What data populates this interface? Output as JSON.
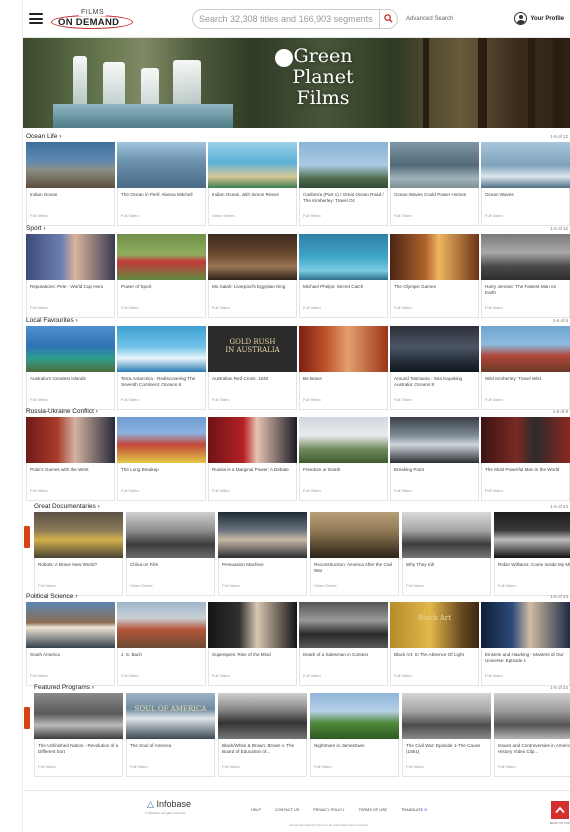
{
  "header": {
    "logo_top": "FILMS",
    "logo_main": "ON DEMAND",
    "search_placeholder": "Search 32,308 titles and 166,903 segments",
    "advanced_search": "Advanced Search",
    "profile_label": "Your Profile"
  },
  "banner": {
    "line1": "Green",
    "line2": "Planet",
    "line3": "Films"
  },
  "sections": [
    {
      "title": "Ocean Life",
      "count": "1-6 of 12",
      "cards": [
        {
          "title": "Indian Ocean",
          "type": "Full Video",
          "bg": "linear-gradient(180deg,#3e6f9c 0%,#5d89b1 40%,#8a8f86 60%,#5c4d3c 100%)"
        },
        {
          "title": "The Ocean in Peril: Alanna Mitchell",
          "type": "Full Video",
          "bg": "linear-gradient(180deg,#9ec3dd 0%,#6a8fab 45%,#4a6b86 100%)"
        },
        {
          "title": "Indian Ocean, with Simon Reeve",
          "type": "Video Series",
          "bg": "linear-gradient(180deg,#9dd0ea 0%,#5bb0d6 45%,#d8c796 75%,#3e7b52 100%)"
        },
        {
          "title": "Canberra (Part 1) / Great Ocean Road / The Kimberley: Travel Oz",
          "type": "Full Video",
          "bg": "linear-gradient(180deg,#8ab3d4 0%,#aacbe3 50%,#4d6b4a 80%,#2e4a36 100%)"
        },
        {
          "title": "Ocean Waves Could Power Homes",
          "type": "Full Video",
          "bg": "linear-gradient(180deg,#7f97a6 0%,#536b78 50%,#9fb3bc 80%,#7f8f95 100%)"
        },
        {
          "title": "Ocean Waves",
          "type": "Full Video",
          "bg": "linear-gradient(180deg,#a9c6db 0%,#7ea2ba 50%,#dbe6ec 75%,#4d6f86 100%)"
        }
      ]
    },
    {
      "title": "Sport",
      "count": "1-6 of 12",
      "cards": [
        {
          "title": "Reputations: Pele - World Cup Hero",
          "type": "Full Video",
          "bg": "linear-gradient(90deg,#3d4a7a 0%,#6c7fae 40%,#d8b49a 55%,#3a3a52 100%)"
        },
        {
          "title": "Power of Sport",
          "type": "Full Video",
          "bg": "linear-gradient(180deg,#6f8f4a 0%,#8fae5c 45%,#c4383a 60%,#5f8b3e 100%)"
        },
        {
          "title": "Mo Salah: Liverpool's Egyptian King",
          "type": "Full Video",
          "bg": "linear-gradient(180deg,#3a2a1e 0%,#6c4a30 45%,#9a7556 70%,#2e241b 100%)"
        },
        {
          "title": "Michael Phelps: Secret Catch",
          "type": "Full Video",
          "bg": "linear-gradient(180deg,#2f7fa6 0%,#3fa7c9 50%,#7ccbe0 80%,#2b6f8e 100%)"
        },
        {
          "title": "The Olympic Games",
          "type": "Full Video",
          "bg": "linear-gradient(90deg,#4a2413 0%,#b0632b 40%,#f0b562 55%,#6b3418 100%)"
        },
        {
          "title": "Harry Jerome: The Fastest Man on Earth",
          "type": "Full Video",
          "bg": "linear-gradient(180deg,#7a7a7a 0%,#a9a9a9 40%,#4a4a4a 70%,#2d2d2d 100%)"
        }
      ]
    },
    {
      "title": "Local Favourites",
      "count": "1-6 of 6",
      "cards": [
        {
          "title": "Australia's Greatest Islands",
          "type": "Full Video",
          "bg": "linear-gradient(180deg,#4f90d0 0%,#2f73b4 45%,#2e9e8e 70%,#4e6b3a 100%)"
        },
        {
          "title": "Terra Antarctica - Rediscovering The Seventh Continent: Oceans 8",
          "type": "Full Video",
          "bg": "linear-gradient(180deg,#3f9fd1 0%,#6fc2e6 45%,#e9f5fb 70%,#2c7db3 100%)"
        },
        {
          "title": "Australian Red Cross, 1940",
          "type": "Full Video",
          "bg": "#2b2b2b",
          "text": "GOLD RUSH\nIN AUSTRALIA"
        },
        {
          "title": "Be Brave",
          "type": "Full Video",
          "bg": "linear-gradient(90deg,#7b1f12 0%,#c0522a 30%,#e3a070 55%,#9c3418 100%)"
        },
        {
          "title": "Around Tasmania - Sea Kayaking Australia: Oceans 8",
          "type": "Full Video",
          "bg": "linear-gradient(180deg,#2b2f38 0%,#4c5566 45%,#27303b 75%,#11161c 100%)"
        },
        {
          "title": "Wild Kimberley: Travel Wild",
          "type": "Full Video",
          "bg": "linear-gradient(180deg,#6fa4d1 0%,#8dbbe0 40%,#b0463a 65%,#6a3a26 100%)"
        }
      ]
    },
    {
      "title": "Russia-Ukraine Conflict",
      "count": "1-6 of 8",
      "cards": [
        {
          "title": "Putin's Games with the West",
          "type": "Full Video",
          "bg": "linear-gradient(90deg,#6f1a18 0%,#a83a2a 35%,#d2b2a0 55%,#2a2a3c 100%)"
        },
        {
          "title": "The Long Breakup",
          "type": "Full Video",
          "bg": "linear-gradient(180deg,#6f9bd1 0%,#8cb2df 35%,#c3483a 60%,#e2c845 100%)"
        },
        {
          "title": "Russia is a Marginal Power: A Debate",
          "type": "Full Video",
          "bg": "linear-gradient(90deg,#6d1416 0%,#b42226 40%,#e7c3b2 55%,#1d1d26 100%)"
        },
        {
          "title": "Freedom or Death",
          "type": "Full Video",
          "bg": "linear-gradient(180deg,#cfd7de 0%,#e9ecef 40%,#6f8a5a 70%,#3f5a2e 100%)"
        },
        {
          "title": "Breaking Point",
          "type": "Full Video",
          "bg": "linear-gradient(180deg,#3b3f45 0%,#7c8a95 40%,#cfd6db 60%,#2b2f35 100%)"
        },
        {
          "title": "The Most Powerful Man in the World",
          "type": "Full Video",
          "bg": "linear-gradient(90deg,#3a1413 0%,#7a2a24 40%,#2b2b2b 60%,#8c2620 100%)"
        }
      ]
    },
    {
      "title": "Great Documentaries",
      "count": "1-6 of 24",
      "indented": true,
      "cards": [
        {
          "title": "Robots: A Brave New World?",
          "type": "Full Video",
          "bg": "linear-gradient(180deg,#5a5246 0%,#8c7a58 40%,#d2b04a 60%,#4a4236 100%)"
        },
        {
          "title": "China on Film",
          "type": "Video Series",
          "bg": "linear-gradient(180deg,#cfcfcf 0%,#8e8e8e 40%,#3c3c3c 70%,#6a6a6a 100%)"
        },
        {
          "title": "Persuasion Machine",
          "type": "Full Video",
          "bg": "linear-gradient(180deg,#1f2a33 0%,#6a7480 40%,#c7b9a4 60%,#2c2f36 100%)"
        },
        {
          "title": "Reconstruction: America After the Civil War",
          "type": "Video Series",
          "bg": "linear-gradient(180deg,#b8a078 0%,#8c7552 45%,#4e3e2a 80%,#2c2318 100%)"
        },
        {
          "title": "Why They Kill",
          "type": "Full Video",
          "bg": "linear-gradient(180deg,#d9d9d9 0%,#a6a6a6 40%,#3c3c3c 70%,#777 100%)"
        },
        {
          "title": "Robin Williams: Come Inside My Mind",
          "type": "Full Video",
          "bg": "linear-gradient(180deg,#1c1c1c 0%,#3a3a3a 40%,#bdbdbd 60%,#111 100%)"
        }
      ]
    },
    {
      "title": "Political Science",
      "count": "1-6 of 24",
      "indented": false,
      "cards": [
        {
          "title": "South America",
          "type": "Full Video",
          "bg": "linear-gradient(180deg,#5c86b5 0%,#8a6e52 45%,#f0e6d6 55%,#35404c 100%)"
        },
        {
          "title": "J. S. Bach",
          "type": "Full Video",
          "bg": "linear-gradient(180deg,#a0b6cc 0%,#c9cfd4 35%,#b4553a 60%,#6a4a34 100%)"
        },
        {
          "title": "Superspies: Rise of the Mind",
          "type": "Full Video",
          "bg": "linear-gradient(90deg,#151515 0%,#303030 35%,#d8c6b2 55%,#141414 100%)"
        },
        {
          "title": "Death of a Salesman in Context",
          "type": "Full Video",
          "bg": "linear-gradient(180deg,#555 0%,#999 40%,#2a2a2a 70%,#5a5a5a 100%)"
        },
        {
          "title": "Black Art: In The Absence Of Light",
          "type": "Full Video",
          "bg": "linear-gradient(90deg,#b88a2c 0%,#e2b84a 45%,#6a4a20 80%,#3a2814 100%)",
          "text": "Black Art"
        },
        {
          "title": "Einstein and Hawking - Masters of Our Universe: Episode 1",
          "type": "Full Video",
          "bg": "linear-gradient(90deg,#0f1e3a 0%,#2c4a7a 35%,#d2bca4 55%,#1c2a44 100%)"
        }
      ]
    },
    {
      "title": "Featured Programs",
      "count": "1-6 of 24",
      "indented": true,
      "cards": [
        {
          "title": "The Unfinished Nation - Revolution of a Different Sort",
          "type": "Full Video",
          "bg": "linear-gradient(180deg,#8a8a8a 0%,#5a5a5a 45%,#bcbcbc 70%,#3c3c3c 100%)"
        },
        {
          "title": "The Soul of America",
          "type": "Full Video",
          "bg": "linear-gradient(180deg,#9db4c7 0%,#6f8aa0 35%,#e0e6ea 55%,#3d4a55 100%)",
          "text": "SOUL OF AMERICA"
        },
        {
          "title": "Black/White & Brown: Brown v. The Board of Education of...",
          "type": "Full Video",
          "bg": "linear-gradient(180deg,#cfcfcf 0%,#8a8a8a 35%,#333 65%,#777 100%)"
        },
        {
          "title": "Nightmare in Jamestown",
          "type": "Full Video",
          "bg": "linear-gradient(180deg,#8fb5d9 0%,#b7d0e6 40%,#4f8a3c 65%,#2f5a22 100%)"
        },
        {
          "title": "The Civil War: Episode 1-The Cause (1861)",
          "type": "Full Video",
          "bg": "linear-gradient(180deg,#d4d4d4 0%,#a4a4a4 40%,#4c4c4c 70%,#8a8a8a 100%)"
        },
        {
          "title": "Issues and Controversies in American History Video Clip...",
          "type": "Full Video",
          "bg": "linear-gradient(180deg,#cfcfcf 0%,#9a9a9a 40%,#555 70%,#b4b4b4 100%)"
        }
      ]
    }
  ],
  "footer": {
    "brand": "Infobase",
    "brand_sub": "© Infobase. All rights reserved.",
    "links": [
      "HELP",
      "CONTACT US",
      "PRIVACY POLICY",
      "TERMS OF USE",
      "TRANSLATE"
    ],
    "note": "Access Provided by Films On Demand Main Demo Account",
    "top_label": "BACK TO TOP"
  },
  "colors": {
    "accent": "#c62828",
    "side_tab": "#d84315"
  }
}
